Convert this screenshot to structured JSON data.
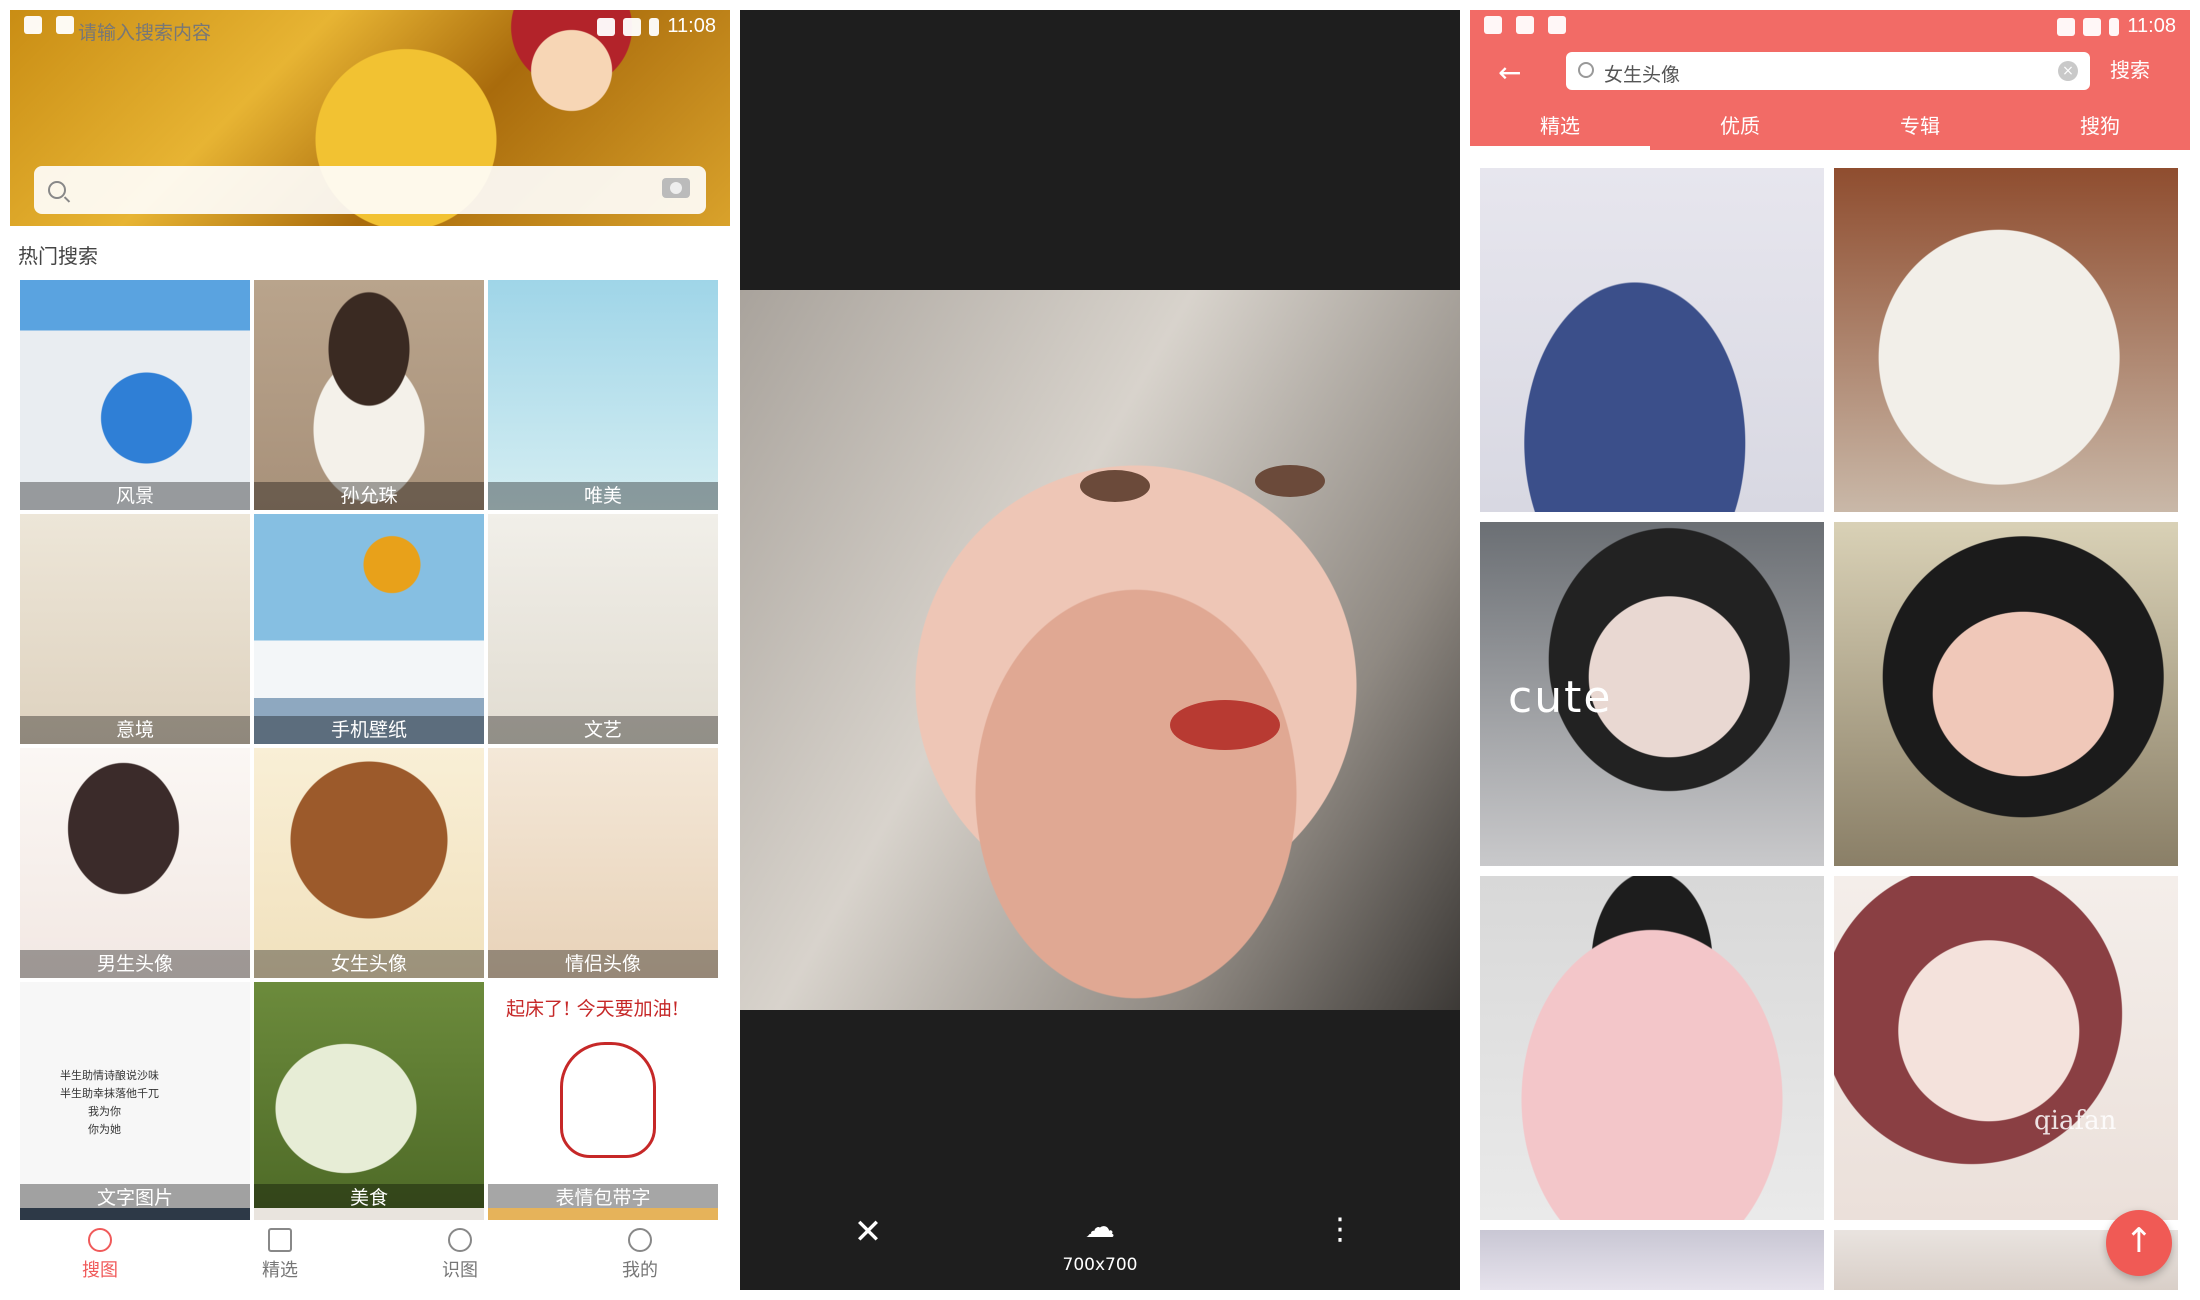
{
  "status": {
    "time": "11:08"
  },
  "home": {
    "search": {
      "placeholder": "请输入搜索内容"
    },
    "hot_title": "热门搜索",
    "categories": [
      {
        "label": "风景"
      },
      {
        "label": "孙允珠"
      },
      {
        "label": "唯美"
      },
      {
        "label": "意境"
      },
      {
        "label": "手机壁纸"
      },
      {
        "label": "文艺"
      },
      {
        "label": "男生头像"
      },
      {
        "label": "女生头像"
      },
      {
        "label": "情侣头像"
      },
      {
        "label": "文字图片"
      },
      {
        "label": "美食"
      },
      {
        "label": "表情包带字"
      }
    ],
    "text_tile_lines": [
      "半生助情诗酿说沙味",
      "半生助幸抹落他千兀",
      "我为你",
      "你为她"
    ],
    "emoji_tile_text": "起床了! 今天要加油!",
    "nav": [
      {
        "label": "搜图",
        "icon": "search-icon",
        "active": true
      },
      {
        "label": "精选",
        "icon": "image-icon",
        "active": false
      },
      {
        "label": "识图",
        "icon": "scan-icon",
        "active": false
      },
      {
        "label": "我的",
        "icon": "user-icon",
        "active": false
      }
    ]
  },
  "viewer": {
    "image_size": "700x700",
    "icons": [
      "close-icon",
      "cloud-download-icon",
      "more-vertical-icon"
    ]
  },
  "results": {
    "query": "女生头像",
    "search_button": "搜索",
    "tabs": [
      {
        "label": "精选",
        "active": true
      },
      {
        "label": "优质",
        "active": false
      },
      {
        "label": "专辑",
        "active": false
      },
      {
        "label": "搜狗",
        "active": false
      }
    ],
    "image_texts": {
      "cute": "cute",
      "qiafan": "qiafan"
    },
    "accent_color": "#f26b66"
  }
}
